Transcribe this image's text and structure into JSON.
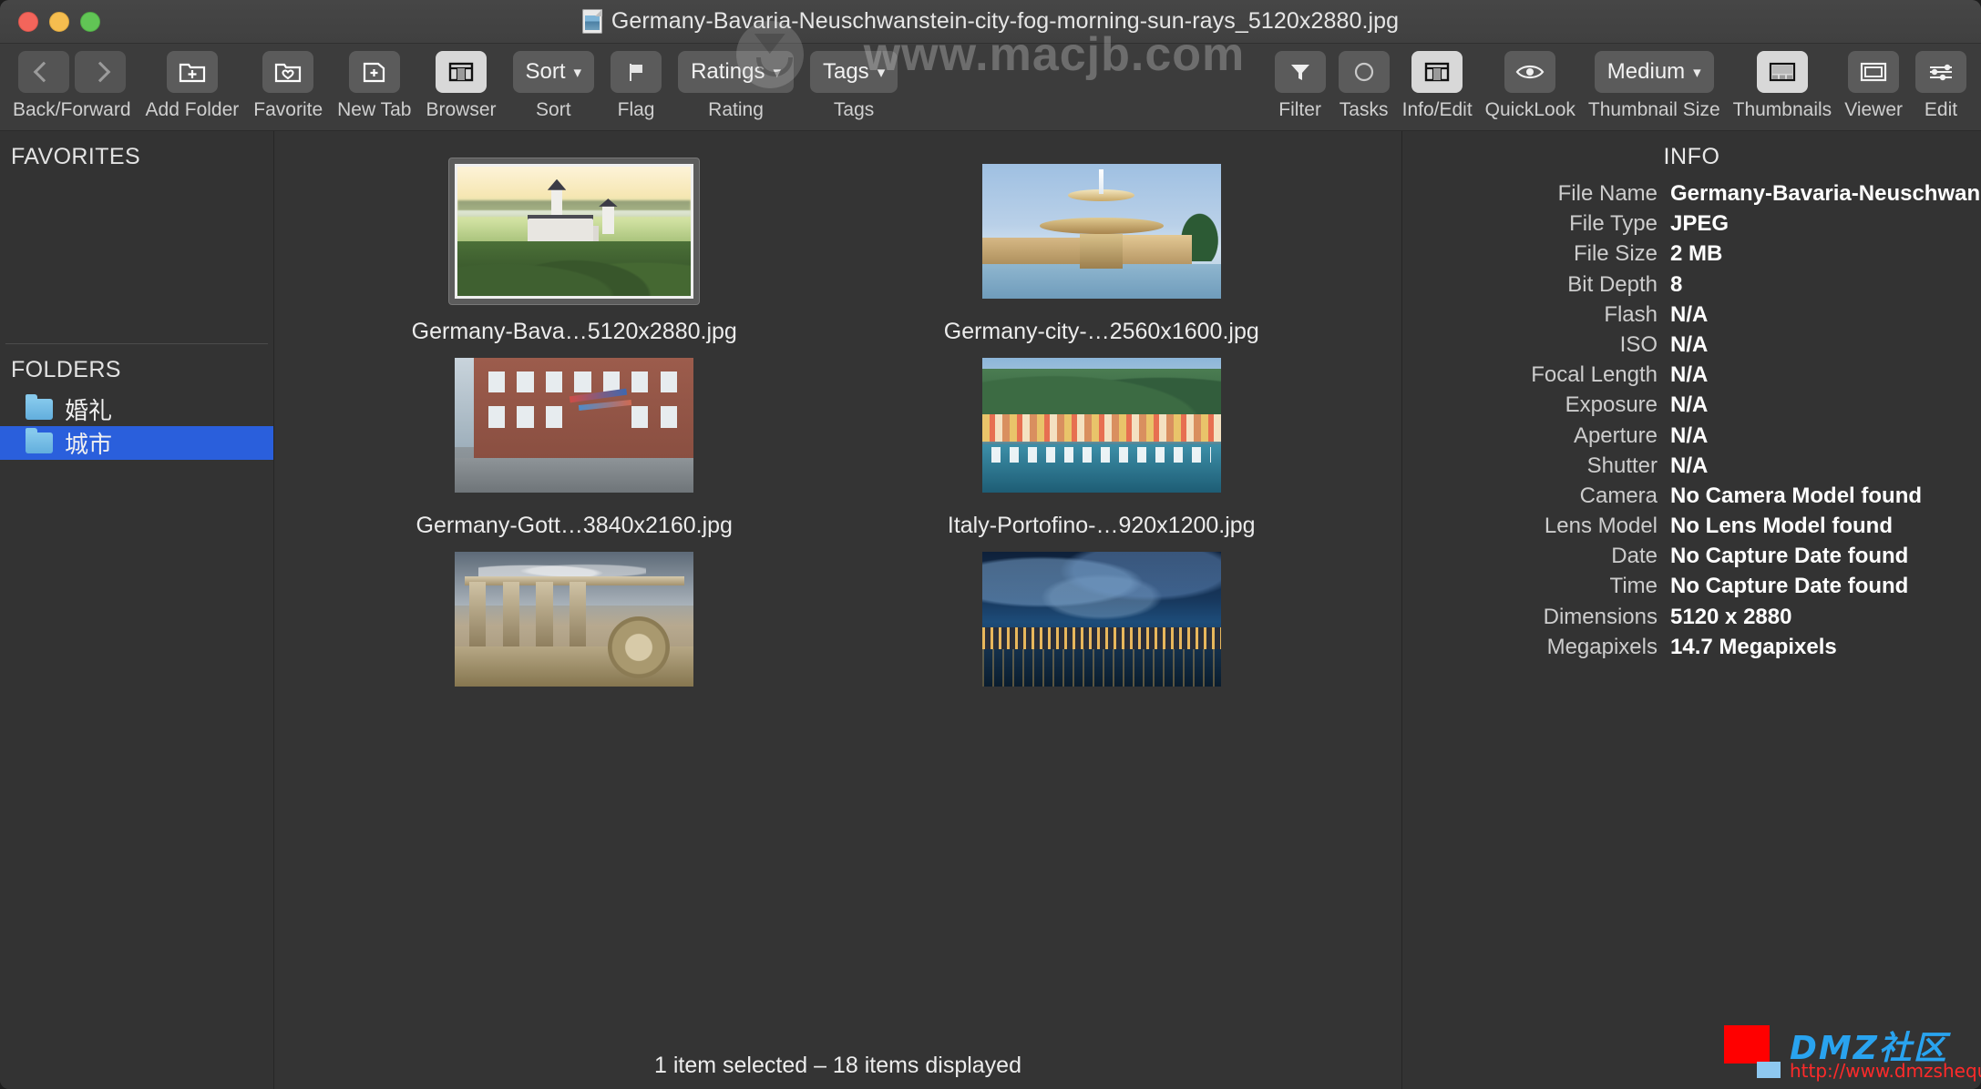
{
  "window": {
    "title": "Germany-Bavaria-Neuschwanstein-city-fog-morning-sun-rays_5120x2880.jpg",
    "doc_icon": "image-document-icon",
    "traffic_lights": [
      "close-button",
      "minimize-button",
      "zoom-button"
    ]
  },
  "watermarks": {
    "top_text": "www.macjb.com",
    "logo_title": "DMZ社区",
    "logo_url": "http://www.dmzshequ.com"
  },
  "toolbar": {
    "groups": [
      {
        "label": "Back/Forward",
        "buttons": [
          {
            "name": "back-button",
            "icon": "chevron-left-icon",
            "text": ""
          },
          {
            "name": "forward-button",
            "icon": "chevron-right-icon",
            "text": ""
          }
        ]
      },
      {
        "label": "Add Folder",
        "buttons": [
          {
            "name": "add-folder-button",
            "icon": "folder-plus-icon",
            "text": ""
          }
        ]
      },
      {
        "label": "Favorite",
        "buttons": [
          {
            "name": "favorite-button",
            "icon": "folder-heart-icon",
            "text": ""
          }
        ]
      },
      {
        "label": "New Tab",
        "buttons": [
          {
            "name": "new-tab-button",
            "icon": "tab-plus-icon",
            "text": ""
          }
        ]
      },
      {
        "label": "Browser",
        "buttons": [
          {
            "name": "browser-button",
            "icon": "columns-icon",
            "text": "",
            "active": true
          }
        ]
      },
      {
        "label": "Sort",
        "buttons": [
          {
            "name": "sort-dropdown",
            "icon": "chevron-down-icon",
            "text": "Sort"
          }
        ]
      },
      {
        "label": "Flag",
        "buttons": [
          {
            "name": "flag-button",
            "icon": "flag-icon",
            "text": ""
          }
        ]
      },
      {
        "label": "Rating",
        "buttons": [
          {
            "name": "ratings-dropdown",
            "icon": "chevron-down-icon",
            "text": "Ratings"
          }
        ]
      },
      {
        "label": "Tags",
        "buttons": [
          {
            "name": "tags-dropdown",
            "icon": "chevron-down-icon",
            "text": "Tags"
          }
        ]
      },
      {
        "label": "Filter",
        "buttons": [
          {
            "name": "filter-button",
            "icon": "funnel-icon",
            "text": ""
          }
        ]
      },
      {
        "label": "Tasks",
        "buttons": [
          {
            "name": "tasks-button",
            "icon": "circle-icon",
            "text": ""
          }
        ]
      },
      {
        "label": "Info/Edit",
        "buttons": [
          {
            "name": "info-edit-button",
            "icon": "columns-icon",
            "text": "",
            "active": true
          }
        ]
      },
      {
        "label": "QuickLook",
        "buttons": [
          {
            "name": "quicklook-button",
            "icon": "eye-icon",
            "text": ""
          }
        ]
      },
      {
        "label": "Thumbnail Size",
        "buttons": [
          {
            "name": "thumbnail-size-dropdown",
            "icon": "chevron-down-icon",
            "text": "Medium"
          }
        ]
      },
      {
        "label": "Thumbnails",
        "buttons": [
          {
            "name": "thumbnails-button",
            "icon": "thumbnails-grid-icon",
            "text": "",
            "active": true
          }
        ]
      },
      {
        "label": "Viewer",
        "buttons": [
          {
            "name": "viewer-button",
            "icon": "viewer-frame-icon",
            "text": ""
          }
        ]
      },
      {
        "label": "Edit",
        "buttons": [
          {
            "name": "edit-button",
            "icon": "sliders-icon",
            "text": ""
          }
        ]
      }
    ]
  },
  "sidebar": {
    "favorites_title": "FAVORITES",
    "favorites_items": [],
    "folders_title": "FOLDERS",
    "folders": [
      {
        "label": "婚礼",
        "icon": "folder-icon",
        "selected": false
      },
      {
        "label": "城市",
        "icon": "folder-icon",
        "selected": true
      }
    ]
  },
  "content": {
    "items": [
      {
        "caption": "Germany-Bava…5120x2880.jpg",
        "art": "art-castle",
        "selected": true
      },
      {
        "caption": "Germany-city-…2560x1600.jpg",
        "art": "art-fountain",
        "selected": false
      },
      {
        "caption": "Germany-Gott…3840x2160.jpg",
        "art": "art-street",
        "selected": false
      },
      {
        "caption": "Italy-Portofino-…920x1200.jpg",
        "art": "art-porto",
        "selected": false
      },
      {
        "caption": "",
        "art": "art-temple",
        "selected": false
      },
      {
        "caption": "",
        "art": "art-night",
        "selected": false
      }
    ],
    "status": "1 item selected – 18 items displayed"
  },
  "info": {
    "title": "INFO",
    "rows": [
      {
        "key": "File Name",
        "value": "Germany-Bavaria-Neuschwan…"
      },
      {
        "key": "File Type",
        "value": "JPEG"
      },
      {
        "key": "File Size",
        "value": "2 MB"
      },
      {
        "key": "Bit Depth",
        "value": "8"
      },
      {
        "key": "Flash",
        "value": "N/A"
      },
      {
        "key": "ISO",
        "value": "N/A"
      },
      {
        "key": "Focal Length",
        "value": "N/A"
      },
      {
        "key": "Exposure",
        "value": "N/A"
      },
      {
        "key": "Aperture",
        "value": "N/A"
      },
      {
        "key": "Shutter",
        "value": "N/A"
      },
      {
        "key": "Camera",
        "value": "No Camera Model found"
      },
      {
        "key": "Lens Model",
        "value": "No Lens Model found"
      },
      {
        "key": "Date",
        "value": "No Capture Date found"
      },
      {
        "key": "Time",
        "value": "No Capture Date found"
      },
      {
        "key": "Dimensions",
        "value": "5120 x 2880"
      },
      {
        "key": "Megapixels",
        "value": "14.7 Megapixels"
      }
    ]
  },
  "colors": {
    "window_bg": "#3a3a3a",
    "panel_bg": "#333333",
    "content_bg": "#343434",
    "accent_selection": "#2a5fdc",
    "toolbar_button": "#5b5b5b",
    "toolbar_button_active": "#d8d8d8"
  }
}
